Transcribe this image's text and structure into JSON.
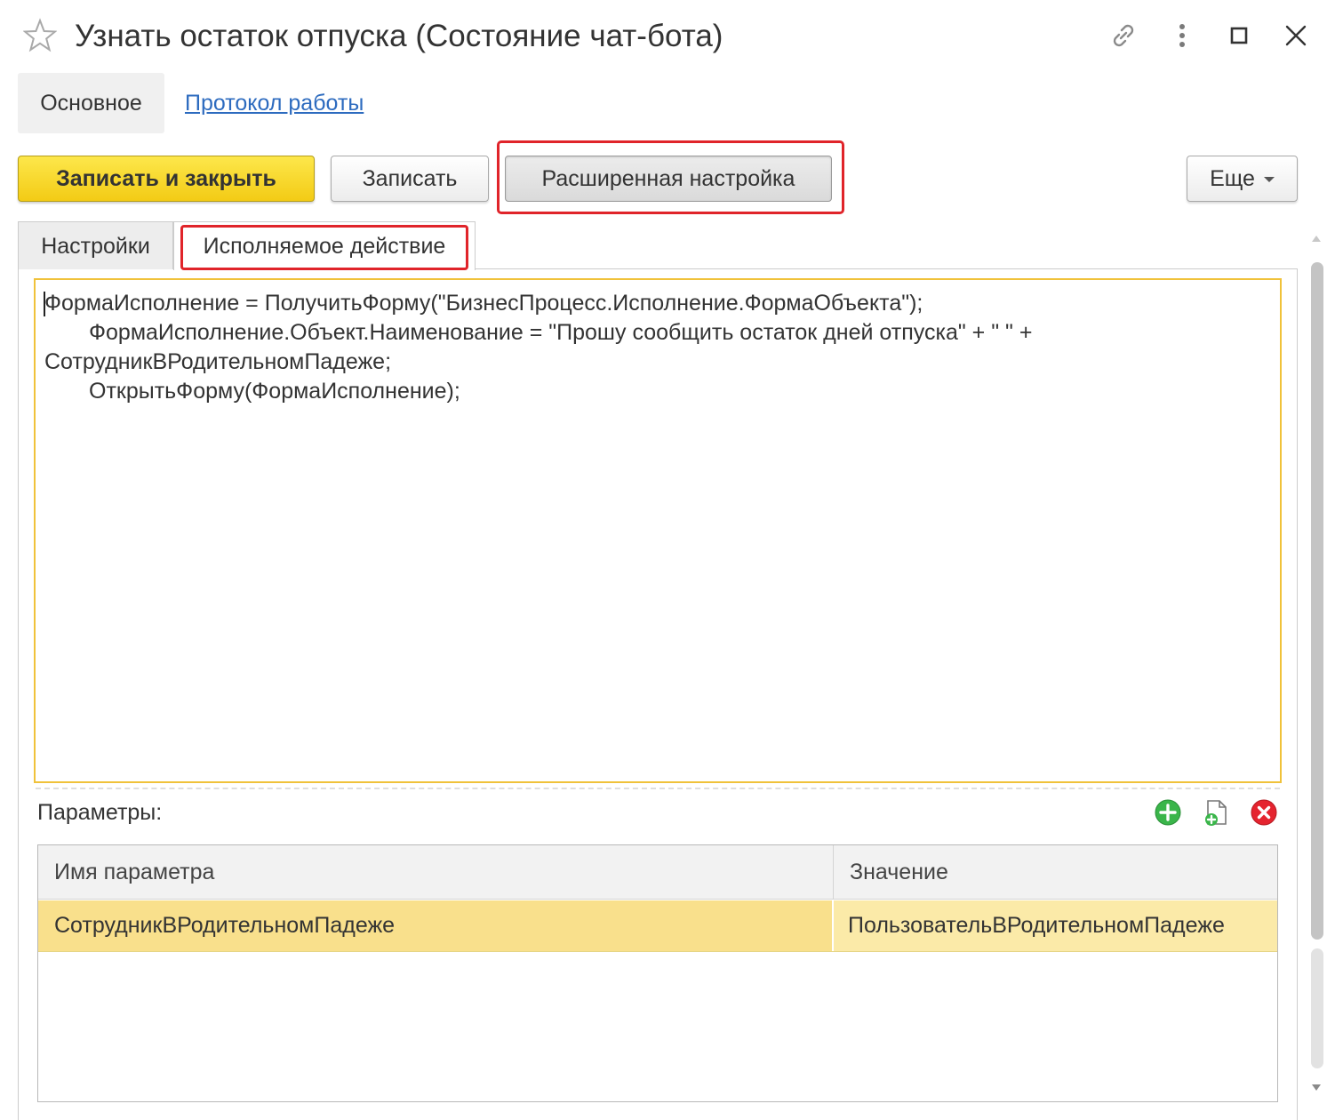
{
  "window": {
    "title": "Узнать остаток отпуска (Состояние чат-бота)",
    "icons": [
      "star-icon",
      "link-icon",
      "more-vertical-icon",
      "maximize-icon",
      "close-icon"
    ]
  },
  "nav": {
    "main_label": "Основное",
    "log_label": "Протокол работы"
  },
  "toolbar": {
    "save_close_label": "Записать и закрыть",
    "save_label": "Записать",
    "advanced_label": "Расширенная настройка",
    "more_label": "Еще"
  },
  "tabs": [
    {
      "label": "Настройки",
      "active": false
    },
    {
      "label": "Исполняемое действие",
      "active": true
    }
  ],
  "editor": {
    "lines": [
      "ФормаИсполнение = ПолучитьФорму(\"БизнесПроцесс.Исполнение.ФормаОбъекта\");",
      "ФормаИсполнение.Объект.Наименование = \"Прошу сообщить остаток дней отпуска\" + \" \" +",
      "СотрудникВРодительномПадеже;",
      "ОткрытьФорму(ФормаИсполнение);"
    ]
  },
  "params": {
    "label": "Параметры:",
    "icons": [
      "add-icon",
      "new-document-icon",
      "delete-icon"
    ],
    "columns": {
      "name": "Имя параметра",
      "value": "Значение"
    },
    "rows": [
      {
        "name": "СотрудникВРодительномПадеже",
        "value": "ПользовательВРодительномПадеже"
      }
    ]
  },
  "colors": {
    "accent_yellow": "#f3cb15",
    "highlight_red": "#e0242a",
    "link_blue": "#2d6bbf",
    "selected_row": "#f9e08c"
  }
}
